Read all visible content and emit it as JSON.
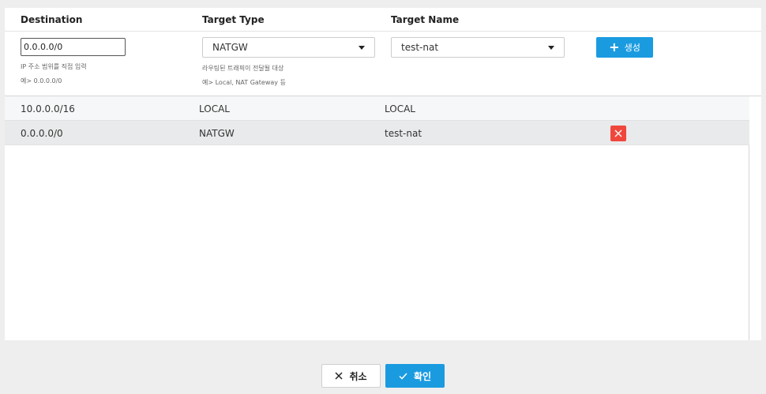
{
  "columns": {
    "destination": "Destination",
    "target_type": "Target Type",
    "target_name": "Target Name"
  },
  "form": {
    "destination_value": "0.0.0.0/0",
    "destination_hint_1": "IP 주소 범위를 직접 입력",
    "destination_hint_2": "예> 0.0.0.0/0",
    "target_type_value": "NATGW",
    "target_type_hint_1": "라우팅된 트래픽이 전달될 대상",
    "target_type_hint_2": "예> Local, NAT Gateway 등",
    "target_name_value": "test-nat",
    "create_label": "생성"
  },
  "routes": [
    {
      "destination": "10.0.0.0/16",
      "target_type": "LOCAL",
      "target_name": "LOCAL"
    },
    {
      "destination": "0.0.0.0/0",
      "target_type": "NATGW",
      "target_name": "test-nat"
    }
  ],
  "footer": {
    "cancel_label": "취소",
    "confirm_label": "확인"
  },
  "colors": {
    "primary": "#1a9be0",
    "danger": "#f0473c"
  }
}
